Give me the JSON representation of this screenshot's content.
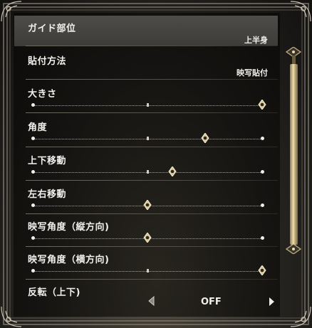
{
  "menu": {
    "items": [
      {
        "label": "ガイド部位",
        "type": "choice",
        "value": "上半身",
        "selected": true
      },
      {
        "label": "貼付方法",
        "type": "choice",
        "value": "映写貼付",
        "selected": false
      },
      {
        "label": "大きさ",
        "type": "slider",
        "level": 1.0,
        "selected": false
      },
      {
        "label": "角度",
        "type": "slider",
        "level": 0.75,
        "selected": false
      },
      {
        "label": "上下移動",
        "type": "slider",
        "level": 0.61,
        "selected": false
      },
      {
        "label": "左右移動",
        "type": "slider",
        "level": 0.5,
        "selected": false
      },
      {
        "label": "映写角度（縦方向)",
        "type": "slider",
        "level": 0.5,
        "selected": false
      },
      {
        "label": "映写角度（横方向)",
        "type": "slider",
        "level": 1.0,
        "selected": false
      },
      {
        "label": "反転（上下)",
        "type": "toggle",
        "value": "OFF",
        "selected": false
      }
    ]
  },
  "scrollbar": {
    "position": 0.0,
    "visible_fraction": 0.95
  },
  "colors": {
    "text": "#f2f0ec",
    "selected_row": "#4e4c48",
    "accent_gold": "#d8c89a"
  }
}
